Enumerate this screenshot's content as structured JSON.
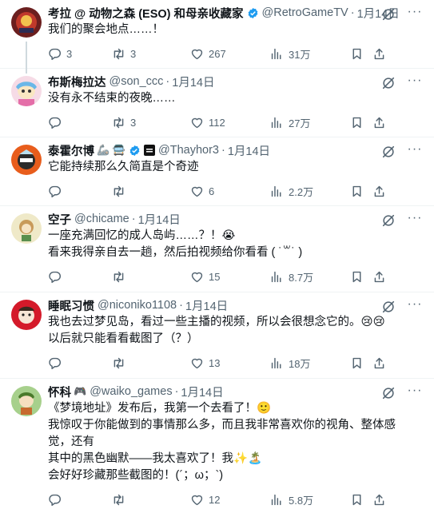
{
  "tweets": [
    {
      "name": "考拉 @ 动物之森 (ESO) 和母亲收藏家",
      "handle": "@RetroGameTV",
      "time": "1月14日",
      "text": [
        "我们的聚会地点……！"
      ],
      "reply": "3",
      "retweet": "3",
      "like": "267",
      "views": "31万",
      "avatar_color": "#7a2a2a"
    },
    {
      "name": "布斯梅拉达",
      "handle": "@son_ccc",
      "time": "1月14日",
      "text": [
        "没有永不结束的夜晚……"
      ],
      "reply": "",
      "retweet": "3",
      "like": "112",
      "views": "27万",
      "avatar_color": "#f3d2e0"
    },
    {
      "name": "泰霍尔博",
      "handle": "@Thayhor3",
      "time": "1月14日",
      "name_emoji": "🦾 🚍",
      "text": [
        "它能持续那么久简直是个奇迹"
      ],
      "reply": "",
      "retweet": "",
      "like": "6",
      "views": "2.2万",
      "avatar_color": "#e85d1c"
    },
    {
      "name": "空子",
      "handle": "@chicame",
      "time": "1月14日",
      "text": [
        "一座充满回忆的成人岛屿……？！😭",
        "看来我得亲自去一趟，然后拍视频给你看看 ( ˙꒳˙ )"
      ],
      "reply": "",
      "retweet": "",
      "like": "15",
      "views": "8.7万",
      "avatar_color": "#efe9c8"
    },
    {
      "name": "睡眠习惯",
      "handle": "@niconiko1108",
      "time": "1月14日",
      "text": [
        "我也去过梦见岛，看过一些主播的视频，所以会很想念它的。😢😢",
        "以后就只能看看截图了（？）"
      ],
      "reply": "",
      "retweet": "",
      "like": "13",
      "views": "18万",
      "avatar_color": "#d41a2a"
    },
    {
      "name": "怀科",
      "name_emoji": "🎮",
      "handle": "@waiko_games",
      "time": "1月14日",
      "text": [
        "《梦境地址》发布后，我第一个去看了！🙂",
        "我惊叹于你能做到的事情那么多，而且我非常喜欢你的视角、整体感觉，还有",
        "其中的黑色幽默——我太喜欢了！我✨🏝️",
        "会好好珍藏那些截图的！(´；ω；`)"
      ],
      "reply": "",
      "retweet": "",
      "like": "12",
      "views": "5.8万",
      "avatar_color": "#a7d08c"
    }
  ]
}
